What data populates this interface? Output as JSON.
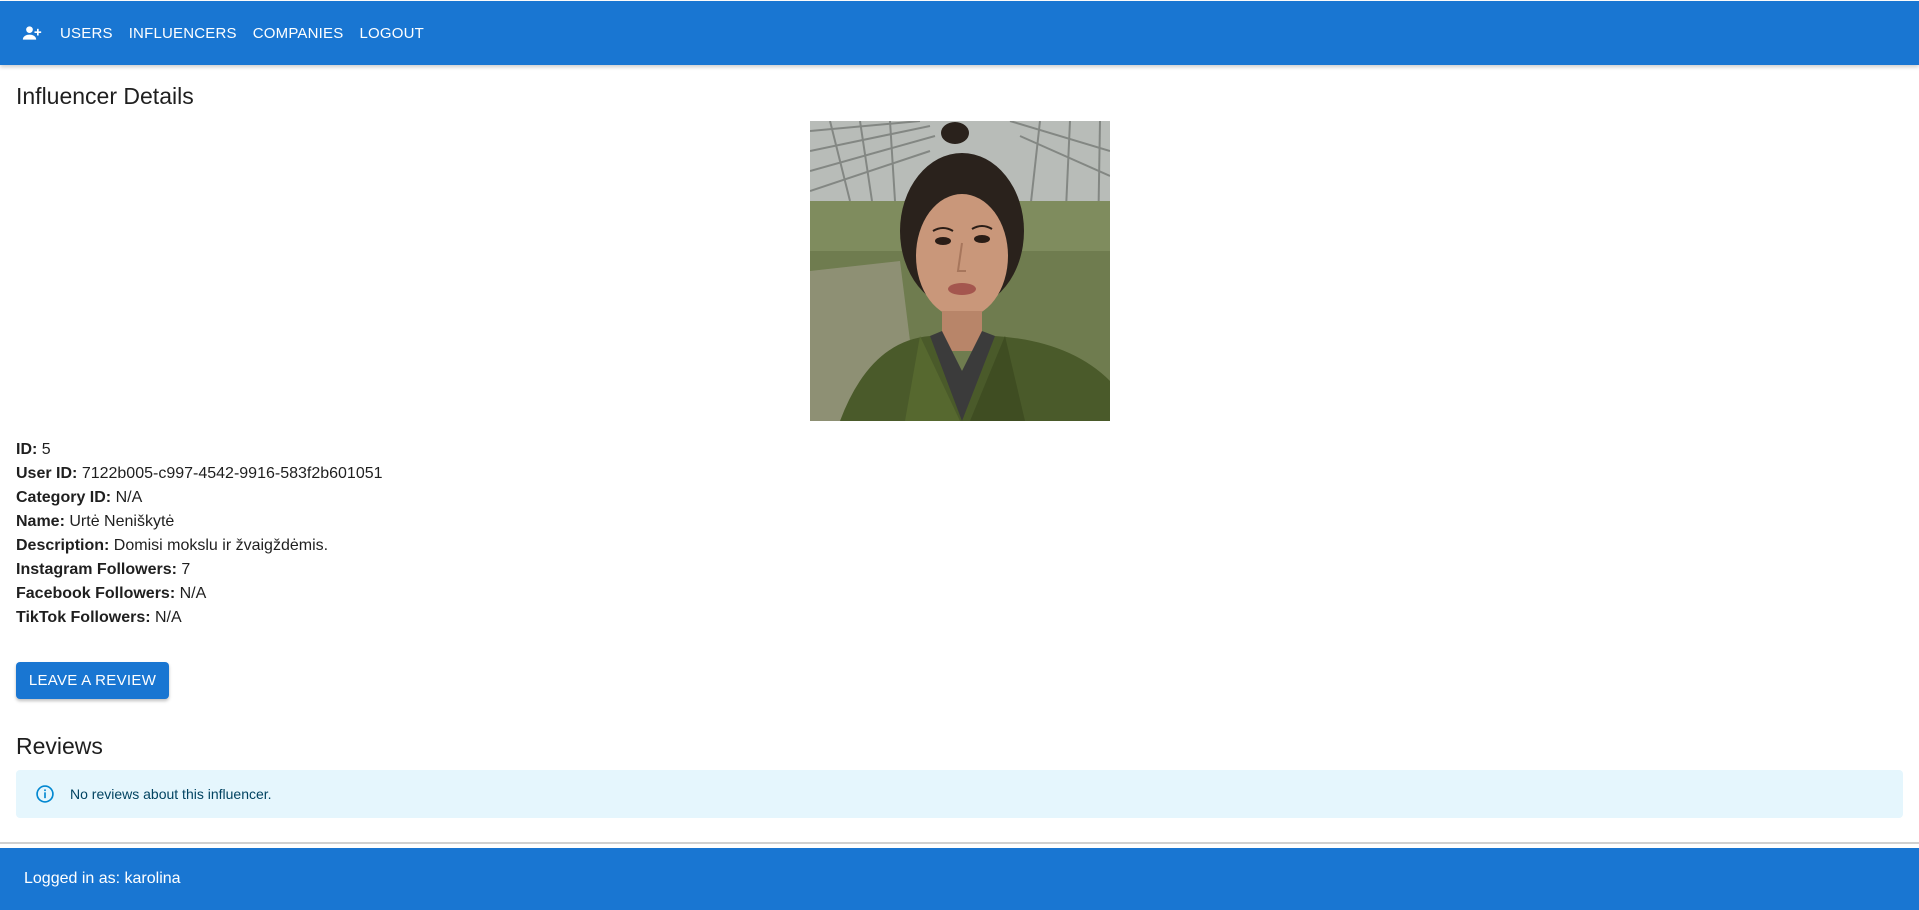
{
  "nav": {
    "icon": "person-add-icon",
    "links": [
      "USERS",
      "INFLUENCERS",
      "COMPANIES",
      "LOGOUT"
    ]
  },
  "page": {
    "title": "Influencer Details"
  },
  "influencer": {
    "fields": [
      {
        "label": "ID:",
        "value": "5"
      },
      {
        "label": "User ID:",
        "value": "7122b005-c997-4542-9916-583f2b601051"
      },
      {
        "label": "Category ID:",
        "value": "N/A"
      },
      {
        "label": "Name:",
        "value": "Urtė Neniškytė"
      },
      {
        "label": "Description:",
        "value": "Domisi mokslu ir žvaigždėmis."
      },
      {
        "label": "Instagram Followers:",
        "value": "7"
      },
      {
        "label": "Facebook Followers:",
        "value": "N/A"
      },
      {
        "label": "TikTok Followers:",
        "value": "N/A"
      }
    ]
  },
  "actions": {
    "review_label": "LEAVE A REVIEW"
  },
  "reviews": {
    "title": "Reviews",
    "empty_message": "No reviews about this influencer.",
    "icon": "info-icon"
  },
  "footer": {
    "text": "Logged in as: karolina"
  },
  "colors": {
    "primary": "#1976d2",
    "info_bg": "#e5f6fd",
    "info_text": "#014361",
    "info_icon": "#0288d1"
  }
}
